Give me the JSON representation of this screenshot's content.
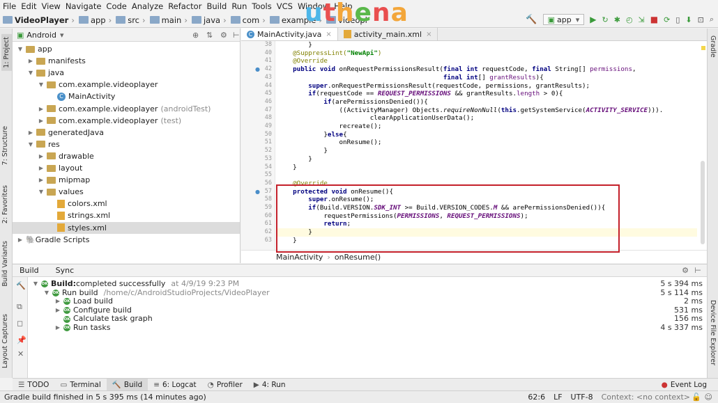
{
  "menu": [
    "File",
    "Edit",
    "View",
    "Navigate",
    "Code",
    "Analyze",
    "Refactor",
    "Build",
    "Run",
    "Tools",
    "VCS",
    "Window",
    "Help"
  ],
  "breadcrumb": [
    "VideoPlayer",
    "app",
    "src",
    "main",
    "java",
    "com",
    "example",
    "videopl"
  ],
  "logo": "uthena",
  "run_config": "app",
  "colors": {
    "logo_u": "#4db6e8",
    "logo_t": "#e94f4f",
    "logo_h": "#f3a63a",
    "logo_e": "#5ab84a",
    "logo_n": "#e94f4f",
    "logo_a": "#f3a63a",
    "highlight_box": "#c4202a",
    "success": "#3f9a3f"
  },
  "left_tabs": [
    "1: Project",
    "7: Structure",
    "2: Favorites",
    "Build Variants",
    "Layout Captures"
  ],
  "right_tabs": [
    "Gradle",
    "Device File Explorer"
  ],
  "project": {
    "view": "Android",
    "tree": [
      {
        "label": "app",
        "extra": "",
        "indent": 0,
        "kind": "folder",
        "arrow": "▼"
      },
      {
        "label": "manifests",
        "extra": "",
        "indent": 1,
        "kind": "folder",
        "arrow": "▶"
      },
      {
        "label": "java",
        "extra": "",
        "indent": 1,
        "kind": "folder",
        "arrow": "▼"
      },
      {
        "label": "com.example.videoplayer",
        "extra": "",
        "indent": 2,
        "kind": "folder",
        "arrow": "▼"
      },
      {
        "label": "MainActivity",
        "extra": "",
        "indent": 3,
        "kind": "class",
        "arrow": ""
      },
      {
        "label": "com.example.videoplayer",
        "extra": "(androidTest)",
        "indent": 2,
        "kind": "folder",
        "arrow": "▶"
      },
      {
        "label": "com.example.videoplayer",
        "extra": "(test)",
        "indent": 2,
        "kind": "folder",
        "arrow": "▶"
      },
      {
        "label": "generatedJava",
        "extra": "",
        "indent": 1,
        "kind": "folder",
        "arrow": "▶"
      },
      {
        "label": "res",
        "extra": "",
        "indent": 1,
        "kind": "folder",
        "arrow": "▼"
      },
      {
        "label": "drawable",
        "extra": "",
        "indent": 2,
        "kind": "folder",
        "arrow": "▶"
      },
      {
        "label": "layout",
        "extra": "",
        "indent": 2,
        "kind": "folder",
        "arrow": "▶"
      },
      {
        "label": "mipmap",
        "extra": "",
        "indent": 2,
        "kind": "folder",
        "arrow": "▶"
      },
      {
        "label": "values",
        "extra": "",
        "indent": 2,
        "kind": "folder",
        "arrow": "▼"
      },
      {
        "label": "colors.xml",
        "extra": "",
        "indent": 3,
        "kind": "xml",
        "arrow": ""
      },
      {
        "label": "strings.xml",
        "extra": "",
        "indent": 3,
        "kind": "xml",
        "arrow": ""
      },
      {
        "label": "styles.xml",
        "extra": "",
        "indent": 3,
        "kind": "xml",
        "arrow": ""
      },
      {
        "label": "Gradle Scripts",
        "extra": "",
        "indent": 0,
        "kind": "gradle",
        "arrow": "▶"
      }
    ]
  },
  "editor": {
    "tabs": [
      {
        "label": "MainActivity.java",
        "icon": "C"
      },
      {
        "label": "activity_main.xml",
        "icon": "x"
      }
    ],
    "line_numbers": [
      "38",
      "40",
      "41",
      "42",
      "43",
      "44",
      "45",
      "46",
      "47",
      "48",
      "49",
      "50",
      "51",
      "52",
      "53",
      "54",
      "55",
      "56",
      "57",
      "58",
      "59",
      "60",
      "61",
      "62",
      "63"
    ],
    "lines": [
      [
        [
          "        }",
          ""
        ]
      ],
      [
        [
          "    ",
          ""
        ],
        [
          "@SuppressLint(",
          "an"
        ],
        [
          "\"NewApi\"",
          "st"
        ],
        [
          ")",
          "an"
        ]
      ],
      [
        [
          "    ",
          ""
        ],
        [
          "@Override",
          "an"
        ]
      ],
      [
        [
          "    ",
          ""
        ],
        [
          "public void ",
          "kw"
        ],
        [
          "onRequestPermissionsResult(",
          ""
        ],
        [
          "final int ",
          "kw"
        ],
        [
          "requestCode, ",
          ""
        ],
        [
          "final ",
          "kw"
        ],
        [
          "String[] ",
          ""
        ],
        [
          "permissions",
          "pm"
        ],
        [
          ",",
          ""
        ]
      ],
      [
        [
          "                                           ",
          ""
        ],
        [
          "final int",
          "kw"
        ],
        [
          "[] ",
          ""
        ],
        [
          "grantResults",
          "pm"
        ],
        [
          "){",
          ""
        ]
      ],
      [
        [
          "        ",
          ""
        ],
        [
          "super",
          "kw"
        ],
        [
          ".onRequestPermissionsResult(requestCode, permissions, grantResults);",
          ""
        ]
      ],
      [
        [
          "        ",
          ""
        ],
        [
          "if",
          "kw"
        ],
        [
          "(requestCode == ",
          ""
        ],
        [
          "REQUEST_PERMISSIONS",
          "cn"
        ],
        [
          " && grantResults.",
          ""
        ],
        [
          "length",
          "pm"
        ],
        [
          " > 0){",
          ""
        ]
      ],
      [
        [
          "            ",
          ""
        ],
        [
          "if",
          "kw"
        ],
        [
          "(arePermissionsDenied()){",
          ""
        ]
      ],
      [
        [
          "                ((ActivityManager) Objects.",
          ""
        ],
        [
          "requireNonNull",
          "it"
        ],
        [
          "(",
          ""
        ],
        [
          "this",
          "kw"
        ],
        [
          ".getSystemService(",
          ""
        ],
        [
          "ACTIVITY_SERVICE",
          "cn"
        ],
        [
          "))).",
          ""
        ]
      ],
      [
        [
          "                        clearApplicationUserData();",
          ""
        ]
      ],
      [
        [
          "                recreate();",
          ""
        ]
      ],
      [
        [
          "            }",
          ""
        ],
        [
          "else",
          "kw"
        ],
        [
          "{",
          ""
        ]
      ],
      [
        [
          "                onResume();",
          ""
        ]
      ],
      [
        [
          "            }",
          ""
        ]
      ],
      [
        [
          "        }",
          ""
        ]
      ],
      [
        [
          "    }",
          ""
        ]
      ],
      [
        [
          "",
          ""
        ]
      ],
      [
        [
          "    ",
          ""
        ],
        [
          "@Override",
          "an"
        ]
      ],
      [
        [
          "    ",
          ""
        ],
        [
          "protected void ",
          "kw"
        ],
        [
          "onResume(){",
          ""
        ]
      ],
      [
        [
          "        ",
          ""
        ],
        [
          "super",
          "kw"
        ],
        [
          ".onResume();",
          ""
        ]
      ],
      [
        [
          "        ",
          ""
        ],
        [
          "if",
          "kw"
        ],
        [
          "(Build.VERSION.",
          ""
        ],
        [
          "SDK_INT",
          "cn"
        ],
        [
          " >= Build.VERSION_CODES.",
          ""
        ],
        [
          "M",
          "cn"
        ],
        [
          " && arePermissionsDenied()){",
          ""
        ]
      ],
      [
        [
          "            requestPermissions(",
          ""
        ],
        [
          "PERMISSIONS",
          "cn"
        ],
        [
          ", ",
          ""
        ],
        [
          "REQUEST_PERMISSIONS",
          "cn"
        ],
        [
          ");",
          ""
        ]
      ],
      [
        [
          "            ",
          ""
        ],
        [
          "return",
          "kw"
        ],
        [
          ";",
          ""
        ]
      ],
      [
        [
          "        }",
          ""
        ]
      ],
      [
        [
          "    }",
          ""
        ]
      ]
    ],
    "crumb": [
      "MainActivity",
      "onResume()"
    ]
  },
  "build": {
    "tabs": [
      "Build",
      "Sync"
    ],
    "rows": [
      {
        "prefix": "",
        "bold": "Build:",
        "text": " completed successfully",
        "meta": "at 4/9/19 9:23 PM",
        "time": "5 s 394 ms",
        "indent": 0,
        "arrow": "▼"
      },
      {
        "prefix": "",
        "bold": "",
        "text": "Run build",
        "meta": "/home/c/AndroidStudioProjects/VideoPlayer",
        "time": "5 s 114 ms",
        "indent": 1,
        "arrow": "▼"
      },
      {
        "prefix": "",
        "bold": "",
        "text": "Load build",
        "meta": "",
        "time": "2 ms",
        "indent": 2,
        "arrow": "▶"
      },
      {
        "prefix": "",
        "bold": "",
        "text": "Configure build",
        "meta": "",
        "time": "531 ms",
        "indent": 2,
        "arrow": "▶"
      },
      {
        "prefix": "",
        "bold": "",
        "text": "Calculate task graph",
        "meta": "",
        "time": "156 ms",
        "indent": 2,
        "arrow": ""
      },
      {
        "prefix": "",
        "bold": "",
        "text": "Run tasks",
        "meta": "",
        "time": "4 s 337 ms",
        "indent": 2,
        "arrow": "▶"
      }
    ]
  },
  "bottom_tabs": [
    {
      "label": "TODO",
      "icon": "☰"
    },
    {
      "label": "Terminal",
      "icon": "▭"
    },
    {
      "label": "Build",
      "icon": "🔨"
    },
    {
      "label": "6: Logcat",
      "icon": "≡"
    },
    {
      "label": "Profiler",
      "icon": "◔"
    },
    {
      "label": "4: Run",
      "icon": "▶"
    }
  ],
  "event_log": "Event Log",
  "status": {
    "message": "Gradle build finished in 5 s 395 ms (14 minutes ago)",
    "position": "62:6",
    "line_sep": "LF",
    "encoding": "UTF-8",
    "context": "Context: <no context>"
  }
}
